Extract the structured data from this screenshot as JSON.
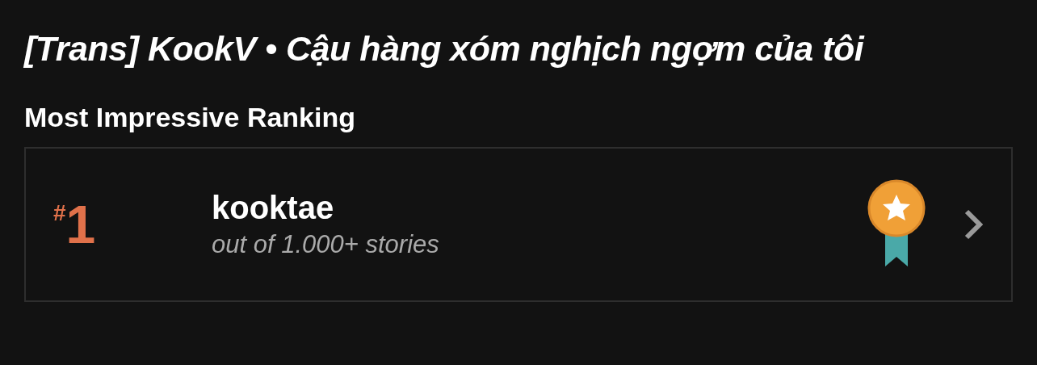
{
  "title": "[Trans] KookV • Cậu hàng xóm nghịch ngợm của tôi",
  "section_title": "Most Impressive Ranking",
  "rankings": [
    {
      "hash": "#",
      "rank": "1",
      "tag": "kooktae",
      "subtitle": "out of 1.000+ stories"
    }
  ]
}
